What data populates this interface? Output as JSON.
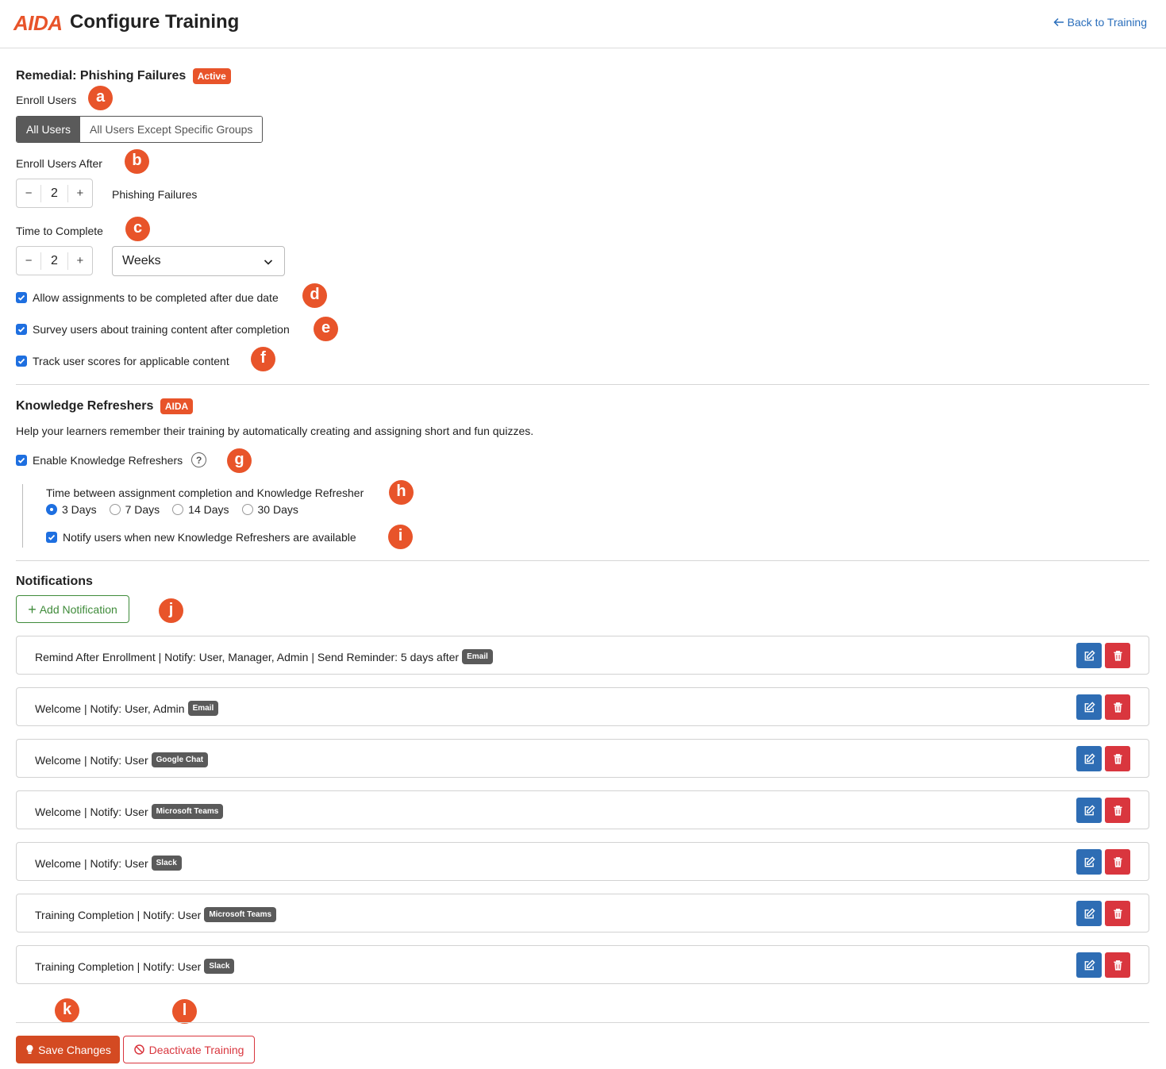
{
  "header": {
    "logo": "AIDA",
    "title": "Configure Training",
    "back_label": "Back to Training"
  },
  "remedial": {
    "title": "Remedial: Phishing Failures",
    "status_badge": "Active",
    "enroll_users_label": "Enroll Users",
    "enroll_options": [
      "All Users",
      "All Users Except Specific Groups"
    ],
    "enroll_selected": "All Users",
    "enroll_after_label": "Enroll Users After",
    "enroll_after_value": "2",
    "enroll_after_unit": "Phishing Failures",
    "time_to_complete_label": "Time to Complete",
    "time_to_complete_value": "2",
    "time_unit": "Weeks",
    "options": [
      {
        "label": "Allow assignments to be completed after due date",
        "checked": true
      },
      {
        "label": "Survey users about training content after completion",
        "checked": true
      },
      {
        "label": "Track user scores for applicable content",
        "checked": true
      }
    ]
  },
  "refreshers": {
    "title": "Knowledge Refreshers",
    "badge": "AIDA",
    "description": "Help your learners remember their training by automatically creating and assigning short and fun quizzes.",
    "enable_label": "Enable Knowledge Refreshers",
    "enable_checked": true,
    "interval_label": "Time between assignment completion and Knowledge Refresher",
    "interval_options": [
      "3 Days",
      "7 Days",
      "14 Days",
      "30 Days"
    ],
    "interval_selected": "3 Days",
    "notify_label": "Notify users when new Knowledge Refreshers are available",
    "notify_checked": true
  },
  "notifications": {
    "title": "Notifications",
    "add_label": "Add Notification",
    "items": [
      {
        "text": "Remind After Enrollment | Notify: User, Manager, Admin | Send Reminder: 5 days after",
        "channel": "Email"
      },
      {
        "text": "Welcome | Notify: User, Admin",
        "channel": "Email"
      },
      {
        "text": "Welcome | Notify: User",
        "channel": "Google Chat"
      },
      {
        "text": "Welcome | Notify: User",
        "channel": "Microsoft Teams"
      },
      {
        "text": "Welcome | Notify: User",
        "channel": "Slack"
      },
      {
        "text": "Training Completion | Notify: User",
        "channel": "Microsoft Teams"
      },
      {
        "text": "Training Completion | Notify: User",
        "channel": "Slack"
      }
    ]
  },
  "footer": {
    "save_label": "Save Changes",
    "deactivate_label": "Deactivate Training"
  },
  "callouts": [
    "a",
    "b",
    "c",
    "d",
    "e",
    "f",
    "g",
    "h",
    "i",
    "j",
    "k",
    "l"
  ],
  "colors": {
    "brand": "#e8542a",
    "primary": "#2e6db4",
    "danger": "#d9363e",
    "success": "#3f8b3a",
    "checkbox": "#1e6fe0"
  }
}
